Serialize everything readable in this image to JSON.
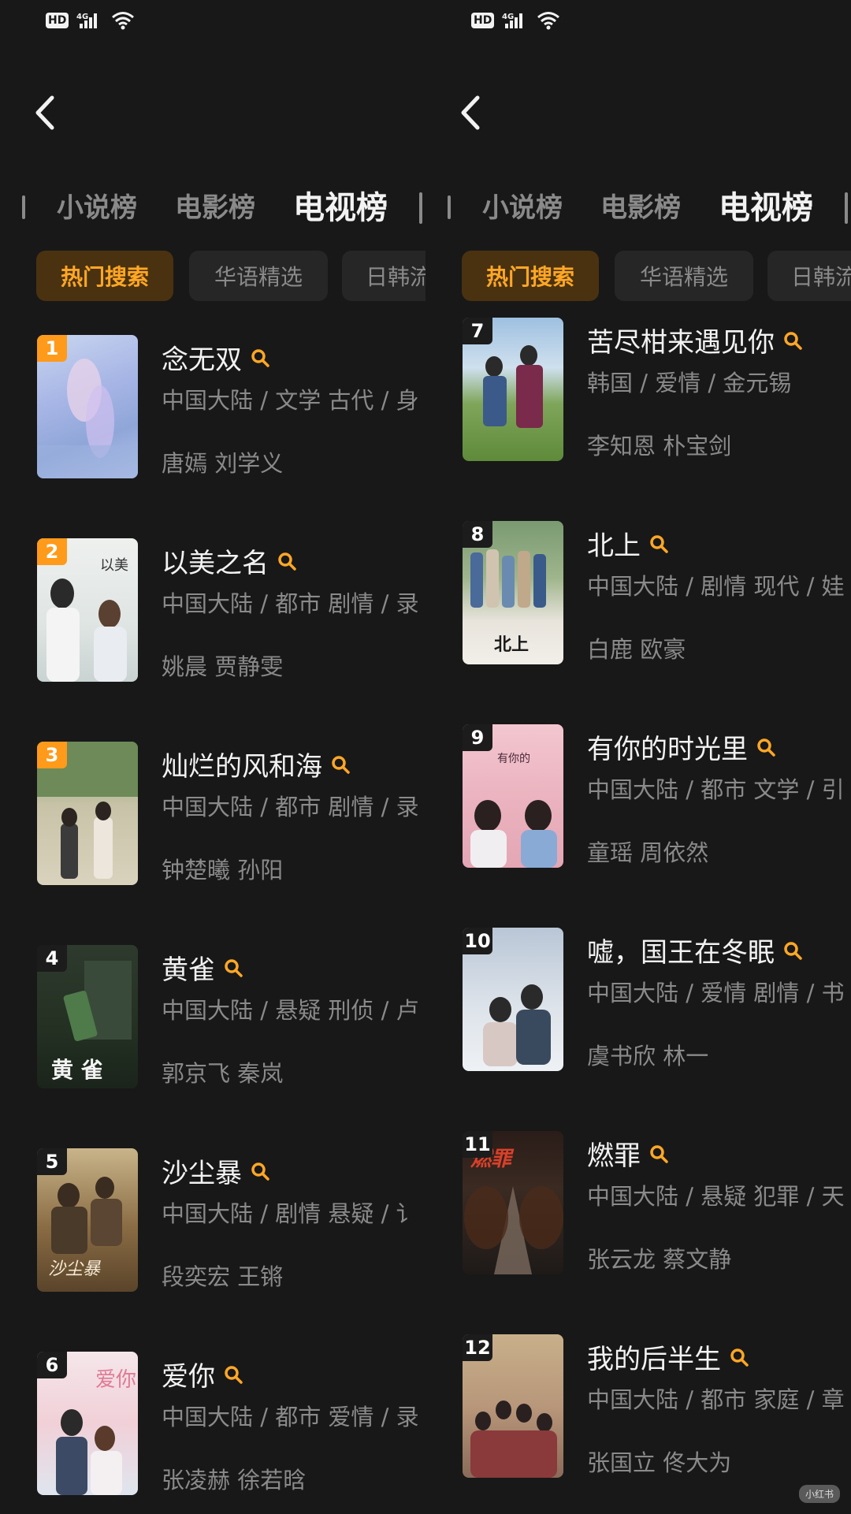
{
  "left": {
    "tabs": [
      "小说榜",
      "电影榜",
      "电视榜"
    ],
    "chips": [
      "热门搜索",
      "华语精选",
      "日韩流"
    ],
    "items": [
      {
        "rank": "1",
        "title": "念无双",
        "meta": "中国大陆 / 文学 古代 / 身",
        "cast": "唐嫣 刘学义"
      },
      {
        "rank": "2",
        "title": "以美之名",
        "meta": "中国大陆 / 都市 剧情 / 录",
        "cast": "姚晨 贾静雯"
      },
      {
        "rank": "3",
        "title": "灿烂的风和海",
        "meta": "中国大陆 / 都市 剧情 / 录",
        "cast": "钟楚曦 孙阳"
      },
      {
        "rank": "4",
        "title": "黄雀",
        "meta": "中国大陆 / 悬疑 刑侦 / 卢",
        "cast": "郭京飞 秦岚"
      },
      {
        "rank": "5",
        "title": "沙尘暴",
        "meta": "中国大陆 / 剧情 悬疑 / 讠",
        "cast": "段奕宏 王锵"
      },
      {
        "rank": "6",
        "title": "爱你",
        "meta": "中国大陆 / 都市 爱情 / 录",
        "cast": "张凌赫 徐若晗"
      }
    ]
  },
  "right": {
    "tabs": [
      "小说榜",
      "电影榜",
      "电视榜"
    ],
    "chips": [
      "热门搜索",
      "华语精选",
      "日韩流"
    ],
    "items": [
      {
        "rank": "7",
        "title": "苦尽柑来遇见你",
        "meta": "韩国 / 爱情 / 金元锡",
        "cast": "李知恩 朴宝剑"
      },
      {
        "rank": "8",
        "title": "北上",
        "meta": "中国大陆 / 剧情 现代 / 娃",
        "cast": "白鹿 欧豪"
      },
      {
        "rank": "9",
        "title": "有你的时光里",
        "meta": "中国大陆 / 都市 文学 / 引",
        "cast": "童瑶 周依然"
      },
      {
        "rank": "10",
        "title": "嘘，国王在冬眠",
        "meta": "中国大陆 / 爱情 剧情 / 书",
        "cast": "虞书欣 林一"
      },
      {
        "rank": "11",
        "title": "燃罪",
        "meta": "中国大陆 / 悬疑 犯罪 / 天",
        "cast": "张云龙 蔡文静"
      },
      {
        "rank": "12",
        "title": "我的后半生",
        "meta": "中国大陆 / 都市 家庭 / 章",
        "cast": "张国立 佟大为"
      }
    ]
  },
  "status": {
    "hd": "HD",
    "net": "4G"
  },
  "colors": {
    "accent": "#ffa726",
    "top_rank": "#ff9a1a",
    "background": "#181818"
  },
  "watermark": "小红书"
}
